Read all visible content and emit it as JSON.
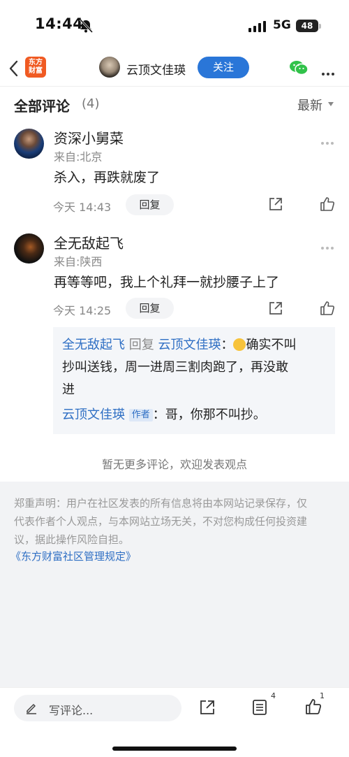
{
  "status": {
    "time": "14:44",
    "network": "5G",
    "battery": "48"
  },
  "nav": {
    "brand_line1": "东方",
    "brand_line2": "财富",
    "username": "云顶文佳瑛",
    "follow_label": "关注"
  },
  "section": {
    "title": "全部评论",
    "count": "(4)",
    "sort_label": "最新"
  },
  "comments": [
    {
      "name": "资深小舅菜",
      "location": "来自:北京",
      "text": "杀入，再跌就废了",
      "time": "今天 14:43",
      "reply_label": "回复"
    },
    {
      "name": "全无敌起飞",
      "location": "来自:陕西",
      "text": "再等等吧，我上个礼拜一就抄腰子上了",
      "time": "今天 14:25",
      "reply_label": "回复"
    }
  ],
  "replies": {
    "first": {
      "from": "全无敌起飞",
      "verb": "回复",
      "to": "云顶文佳瑛",
      "colon": "：",
      "line1": "确实不叫",
      "line2": "抄叫送钱，周一进周三割肉跑了，再没敢",
      "line3": "进"
    },
    "second": {
      "from": "云顶文佳瑛",
      "tag": "作者",
      "colon": "：",
      "text": "哥，你那不叫抄。"
    }
  },
  "no_more": "暂无更多评论，欢迎发表观点",
  "disclaimer": {
    "line1": "郑重声明：用户在社区发表的所有信息将由本网站记录保存，仅",
    "line2": "代表作者个人观点，与本网站立场无关，不对您构成任何投资建",
    "line3": "议，据此操作风险自担。",
    "link": "《东方财富社区管理规定》"
  },
  "bottom": {
    "placeholder": "写评论...",
    "list_count": "4",
    "like_count": "1"
  },
  "colors": {
    "accent": "#2a76d8",
    "brand": "#f05a22",
    "link": "#2f6fc4",
    "wechat": "#31c24a"
  },
  "icons": [
    "bell-muted-icon",
    "signal-icon",
    "back-icon",
    "wechat-icon",
    "more-icon",
    "share-icon",
    "like-icon",
    "pen-icon",
    "list-icon",
    "emoji-icon"
  ]
}
